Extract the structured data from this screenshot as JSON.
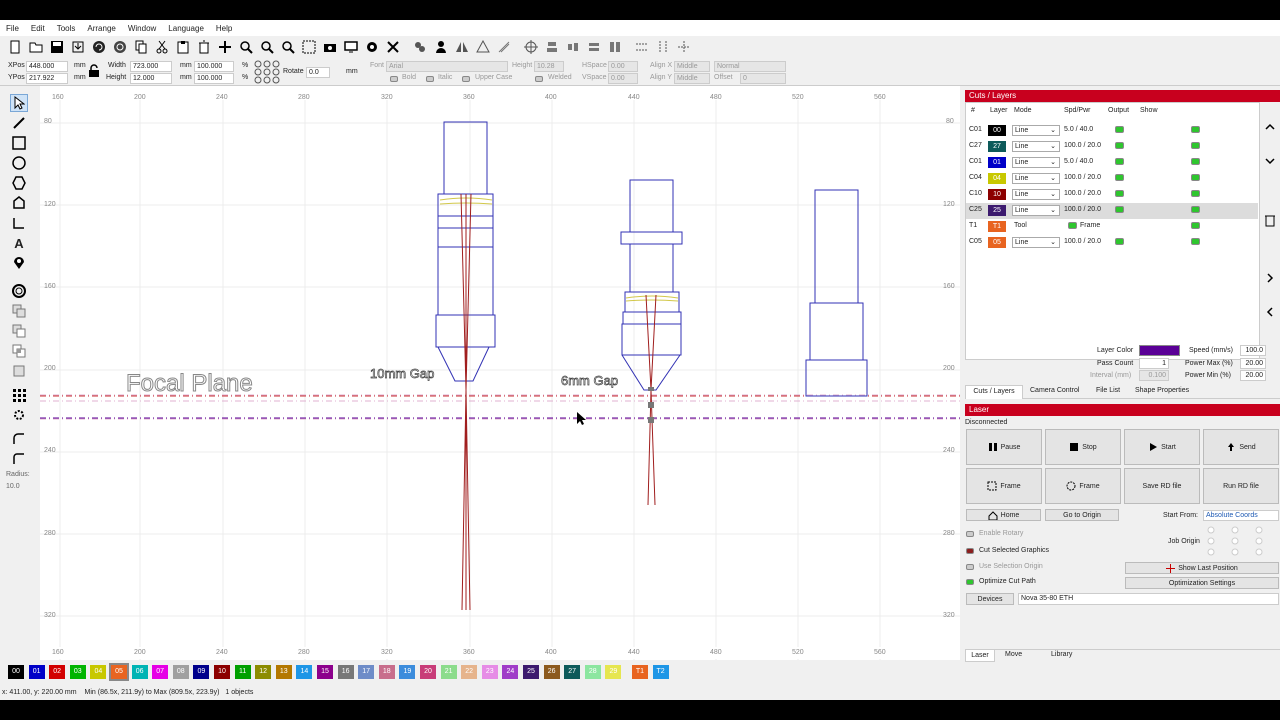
{
  "menu": [
    "File",
    "Edit",
    "Tools",
    "Arrange",
    "Window",
    "Language",
    "Help"
  ],
  "options": {
    "xpos_label": "XPos",
    "xpos": "448.000",
    "ypos_label": "YPos",
    "ypos": "217.922",
    "unit": "mm",
    "width_label": "Width",
    "width": "723.000",
    "height_label": "Height",
    "height": "12.000",
    "scale_w": "100.000",
    "scale_h": "100.000",
    "pct": "%",
    "rotate_label": "Rotate",
    "rotate": "0.0",
    "rotate_unit": "mm",
    "font_label": "Font",
    "font": "Arial",
    "fheight_label": "Height",
    "fheight": "10.28",
    "hspace_label": "HSpace",
    "hspace": "0.00",
    "vspace_label": "VSpace",
    "vspace": "0.00",
    "alignx_label": "Align X",
    "alignx": "Middle",
    "aligny_label": "Align Y",
    "aligny": "Middle",
    "normal": "Normal",
    "offset_label": "Offset",
    "offset": "0",
    "bold": "Bold",
    "italic": "Italic",
    "upper": "Upper Case",
    "welded": "Welded"
  },
  "ruler_x": [
    "160",
    "200",
    "240",
    "280",
    "320",
    "360",
    "400",
    "440",
    "480",
    "520",
    "560"
  ],
  "ruler_y": [
    "80",
    "120",
    "160",
    "200",
    "240",
    "280",
    "320"
  ],
  "canvas_text": {
    "focal": "Focal Plane",
    "gap10": "10mm Gap",
    "gap6": "6mm Gap"
  },
  "radius_label": "Radius:",
  "radius": "10.0",
  "cuts": {
    "title": "Cuts / Layers",
    "headers": [
      "#",
      "Layer",
      "Mode",
      "Spd/Pwr",
      "Output",
      "Show"
    ],
    "rows": [
      {
        "num": "C01",
        "layer": "00",
        "color": "#000000",
        "mode": "Line",
        "sp": "5.0 / 40.0"
      },
      {
        "num": "C27",
        "layer": "27",
        "color": "#0d5a5a",
        "mode": "Line",
        "sp": "100.0 / 20.0"
      },
      {
        "num": "C01",
        "layer": "01",
        "color": "#0000c8",
        "mode": "Line",
        "sp": "5.0 / 40.0"
      },
      {
        "num": "C04",
        "layer": "04",
        "color": "#c8c800",
        "mode": "Line",
        "sp": "100.0 / 20.0"
      },
      {
        "num": "C10",
        "layer": "10",
        "color": "#8c0000",
        "mode": "Line",
        "sp": "100.0 / 20.0"
      },
      {
        "num": "C25",
        "layer": "25",
        "color": "#3c1a6e",
        "mode": "Line",
        "sp": "100.0 / 20.0"
      },
      {
        "num": "T1",
        "layer": "T1",
        "color": "#e86420",
        "mode": "Tool",
        "sp": "Frame"
      },
      {
        "num": "C05",
        "layer": "05",
        "color": "#e86420",
        "mode": "Line",
        "sp": "100.0 / 20.0"
      }
    ],
    "layer_color_label": "Layer Color",
    "layer_color": "#5a0096",
    "speed_label": "Speed (mm/s)",
    "speed": "100.0",
    "pass_label": "Pass Count",
    "pass": "1",
    "pmax_label": "Power Max (%)",
    "pmax": "20.00",
    "interval_label": "Interval (mm)",
    "interval": "0.100",
    "pmin_label": "Power Min (%)",
    "pmin": "20.00",
    "tabs": [
      "Cuts / Layers",
      "Camera Control",
      "File List",
      "Shape Properties"
    ]
  },
  "laser": {
    "title": "Laser",
    "status": "Disconnected",
    "pause": "Pause",
    "stop": "Stop",
    "start": "Start",
    "send": "Send",
    "frame1": "Frame",
    "frame2": "Frame",
    "save_rd": "Save RD file",
    "run_rd": "Run RD file",
    "home": "Home",
    "goto_origin": "Go to Origin",
    "start_from_label": "Start From:",
    "start_from": "Absolute Coords",
    "job_origin": "Job Origin",
    "enable_rotary": "Enable Rotary",
    "cut_selected": "Cut Selected Graphics",
    "use_selection": "Use Selection Origin",
    "optimize": "Optimize Cut Path",
    "show_last": "Show Last Position",
    "opt_settings": "Optimization Settings",
    "devices": "Devices",
    "device": "Nova 35-80 ETH",
    "tabs": [
      "Laser",
      "Move",
      "Library"
    ]
  },
  "palette": [
    {
      "l": "00",
      "c": "#000000"
    },
    {
      "l": "01",
      "c": "#0000c8"
    },
    {
      "l": "02",
      "c": "#d20000"
    },
    {
      "l": "03",
      "c": "#00b400"
    },
    {
      "l": "04",
      "c": "#c8c800"
    },
    {
      "l": "05",
      "c": "#e86420"
    },
    {
      "l": "06",
      "c": "#00b4b4"
    },
    {
      "l": "07",
      "c": "#e600e6"
    },
    {
      "l": "08",
      "c": "#a0a0a0"
    },
    {
      "l": "09",
      "c": "#00008c"
    },
    {
      "l": "10",
      "c": "#8c0000"
    },
    {
      "l": "11",
      "c": "#00a000"
    },
    {
      "l": "12",
      "c": "#8c8c00"
    },
    {
      "l": "13",
      "c": "#b47800"
    },
    {
      "l": "14",
      "c": "#1e96e6"
    },
    {
      "l": "15",
      "c": "#8c008c"
    },
    {
      "l": "16",
      "c": "#787878"
    },
    {
      "l": "17",
      "c": "#6e8cc8"
    },
    {
      "l": "18",
      "c": "#c86e8c"
    },
    {
      "l": "19",
      "c": "#3c8cdc"
    },
    {
      "l": "20",
      "c": "#c83c78"
    },
    {
      "l": "21",
      "c": "#8cdc8c"
    },
    {
      "l": "22",
      "c": "#e6b48c"
    },
    {
      "l": "23",
      "c": "#e68ce6"
    },
    {
      "l": "24",
      "c": "#a03cc8"
    },
    {
      "l": "25",
      "c": "#3c1a6e"
    },
    {
      "l": "26",
      "c": "#8c5a1e"
    },
    {
      "l": "27",
      "c": "#0d5a5a"
    },
    {
      "l": "28",
      "c": "#8ce6a0"
    },
    {
      "l": "29",
      "c": "#e6e650"
    },
    {
      "l": "T1",
      "c": "#e86420"
    },
    {
      "l": "T2",
      "c": "#1e96e6"
    }
  ],
  "status": {
    "coords": "x: 411.00, y: 220.00 mm",
    "minmax": "Min (86.5x, 211.9y) to Max (809.5x, 223.9y)",
    "objects": "1 objects"
  }
}
